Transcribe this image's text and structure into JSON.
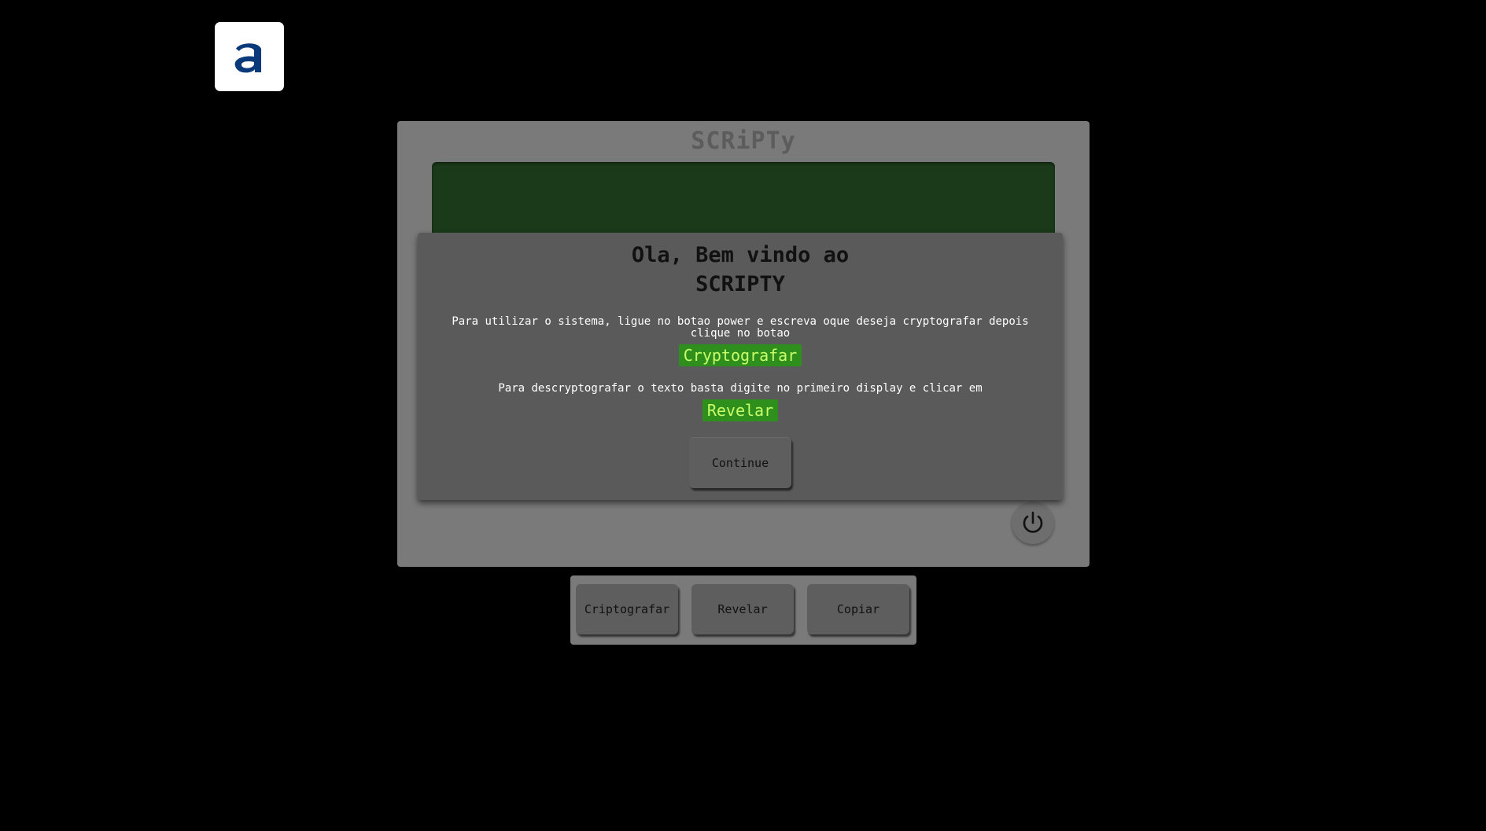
{
  "logo": {
    "letter": "a",
    "icon": "alura-logo-icon",
    "color": "#0b3a7a"
  },
  "device": {
    "title": "SCRiPTy",
    "screen_color": "#1a3a1a",
    "power_icon": "power-icon"
  },
  "modal": {
    "title_line1": "Ola, Bem vindo ao",
    "title_line2": "SCRIPTY",
    "text1": "Para utilizar o sistema, ligue no botao power e escreva oque deseja cryptografar depois clique no botao",
    "highlight1": "Cryptografar",
    "text2": "Para descryptografar o texto basta digite no primeiro display e clicar em",
    "highlight2": "Revelar",
    "continue_label": "Continue",
    "highlight_bg": "#2f8f1c",
    "highlight_fg": "#c8ff6a"
  },
  "actions": {
    "encrypt_label": "Criptografar",
    "reveal_label": "Revelar",
    "copy_label": "Copiar"
  }
}
